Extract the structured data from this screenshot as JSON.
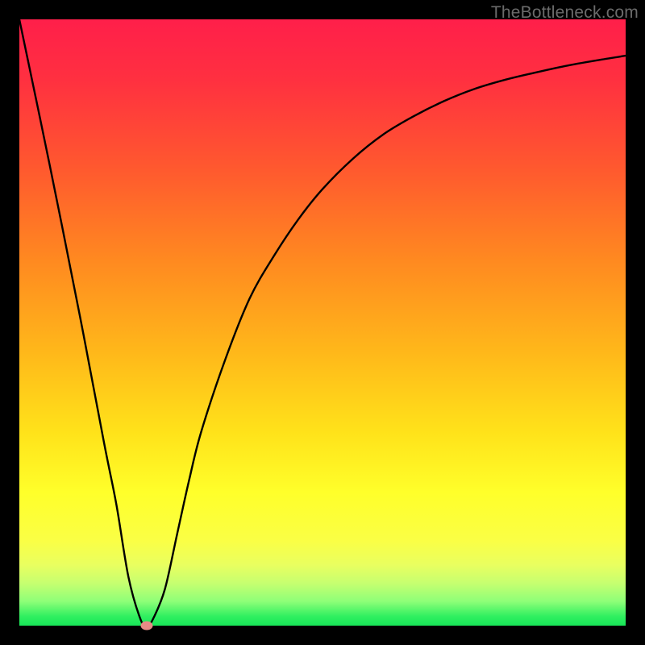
{
  "watermark": "TheBottleneck.com",
  "chart_data": {
    "type": "line",
    "title": "",
    "xlabel": "",
    "ylabel": "",
    "xlim": [
      0,
      100
    ],
    "ylim": [
      0,
      100
    ],
    "x": [
      0,
      5,
      10,
      14,
      16,
      18,
      20,
      21,
      22,
      24,
      26,
      28,
      30,
      34,
      38,
      42,
      46,
      50,
      55,
      60,
      65,
      70,
      75,
      80,
      85,
      90,
      95,
      100
    ],
    "values": [
      100,
      76,
      51,
      30,
      20,
      8,
      1,
      0,
      1,
      6,
      15,
      24,
      32,
      44,
      54,
      61,
      67,
      72,
      77,
      81,
      84,
      86.5,
      88.5,
      90,
      91.2,
      92.3,
      93.2,
      94
    ],
    "minimum_x": 21,
    "minimum_y": 0,
    "marker": {
      "x": 21,
      "y": 0
    },
    "background_gradient": {
      "top": "#ff1f4a",
      "bottom": "#18e658",
      "orientation": "vertical"
    }
  }
}
